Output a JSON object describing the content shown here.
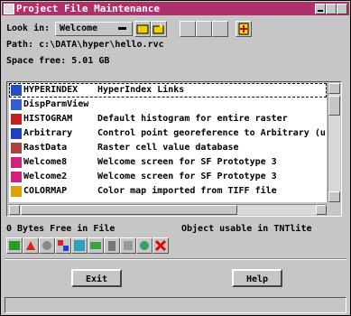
{
  "window": {
    "title": "Project File Maintenance"
  },
  "lookin": {
    "label": "Look in:",
    "value": "Welcome"
  },
  "path": {
    "label": "Path:",
    "value": "c:\\DATA\\hyper\\hello.rvc"
  },
  "space": {
    "label": "Space free:",
    "value": "5.01 GB"
  },
  "list": {
    "items": [
      {
        "name": "HYPERINDEX",
        "desc": "HyperIndex Links",
        "icon": "hyperindex-icon",
        "selected": true
      },
      {
        "name": "DispParmView",
        "desc": "",
        "icon": "display-params-icon"
      },
      {
        "name": "HISTOGRAM",
        "desc": "Default histogram for entire raster",
        "icon": "histogram-icon"
      },
      {
        "name": "Arbitrary",
        "desc": "Control point georeference to Arbitrary (u",
        "icon": "georeference-icon"
      },
      {
        "name": "RastData",
        "desc": "Raster cell value database",
        "icon": "database-icon"
      },
      {
        "name": "Welcome8",
        "desc": "Welcome screen for SF Prototype 3",
        "icon": "raster-icon"
      },
      {
        "name": "Welcome2",
        "desc": "Welcome screen for SF Prototype 3",
        "icon": "raster-icon"
      },
      {
        "name": "COLORMAP",
        "desc": "Color map imported from TIFF file",
        "icon": "colormap-icon"
      }
    ]
  },
  "status": {
    "free": "0 Bytes Free in File",
    "usable": "Object usable in TNTlite"
  },
  "buttons": {
    "exit": "Exit",
    "help": "Help"
  },
  "colors": {
    "titlebar": "#b0306c",
    "face": "#c6c6c6"
  }
}
